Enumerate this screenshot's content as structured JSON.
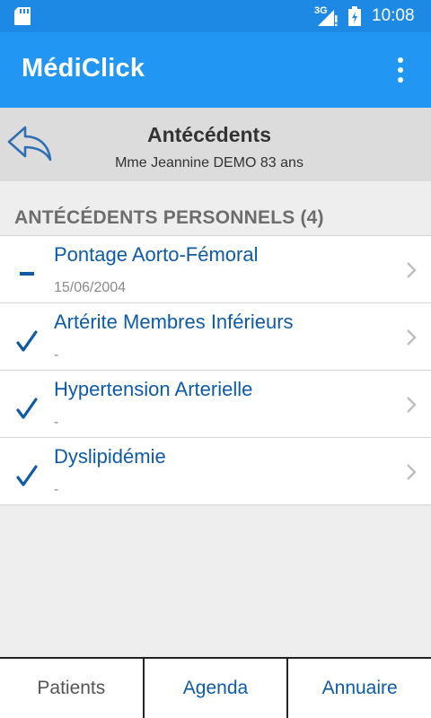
{
  "status_bar": {
    "network_label": "3G",
    "time": "10:08"
  },
  "app_bar": {
    "title": "MédiClick"
  },
  "header": {
    "title": "Antécédents",
    "subtitle": "Mme Jeannine DEMO 83 ans"
  },
  "section": {
    "title": "ANTÉCÉDENTS PERSONNELS (4)"
  },
  "items": [
    {
      "title": "Pontage Aorto-Fémoral",
      "subtitle": "15/06/2004",
      "status": "dash-icon"
    },
    {
      "title": "Artérite Membres Inférieurs",
      "subtitle": "-",
      "status": "check-icon"
    },
    {
      "title": "Hypertension Arterielle",
      "subtitle": "-",
      "status": "check-icon"
    },
    {
      "title": "Dyslipidémie",
      "subtitle": "-",
      "status": "check-icon"
    }
  ],
  "bottom_nav": {
    "patients": "Patients",
    "agenda": "Agenda",
    "annuaire": "Annuaire"
  },
  "colors": {
    "status_bar": "#1e88e5",
    "app_bar": "#2196f3",
    "link_blue": "#0d5ba8",
    "header_bg": "#dcdcdc"
  }
}
